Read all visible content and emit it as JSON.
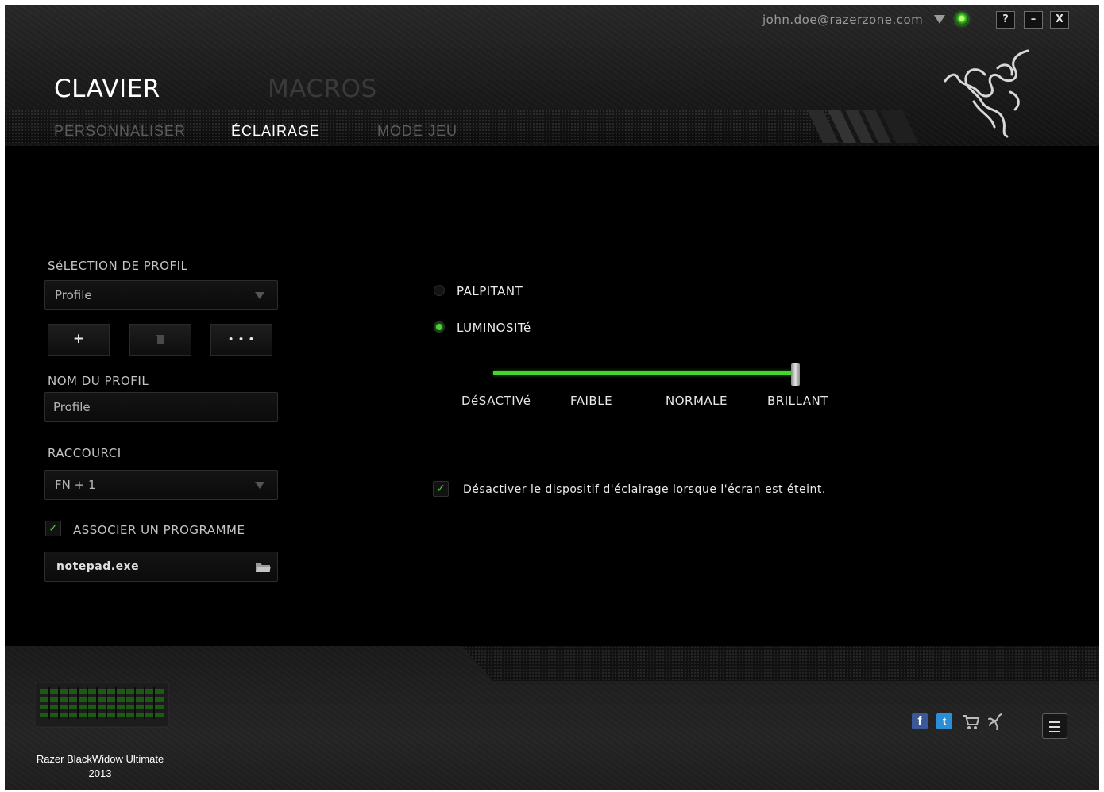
{
  "account": {
    "email": "john.doe@razerzone.com"
  },
  "window_controls": {
    "help": "?",
    "minimize": "–",
    "close": "X"
  },
  "tabs": {
    "primary": [
      "CLAVIER",
      "MACROS"
    ],
    "secondary": [
      "PERSONNALISER",
      "ÉCLAIRAGE",
      "MODE JEU"
    ]
  },
  "profile": {
    "selection_label": "SéLECTION DE PROFIL",
    "selected": "Profile",
    "add": "+",
    "more": "• • •",
    "name_label": "NOM DU PROFIL",
    "name_value": "Profile",
    "shortcut_label": "RACCOURCI",
    "shortcut_value": "FN + 1",
    "link_program_label": "ASSOCIER UN PROGRAMME",
    "link_program_checked": true,
    "program_path": "notepad.exe"
  },
  "lighting": {
    "pulsating_label": "PALPITANT",
    "pulsating_selected": false,
    "brightness_label": "LUMINOSITé",
    "brightness_selected": true,
    "levels": [
      "DéSACTIVé",
      "FAIBLE",
      "NORMALE",
      "BRILLANT"
    ],
    "brightness_level": "BRILLANT",
    "screen_off_label": "Désactiver le dispositif d'éclairage lorsque l'écran est éteint.",
    "screen_off_checked": true
  },
  "device": {
    "name_line1": "Razer BlackWidow Ultimate",
    "name_line2": "2013"
  },
  "footer_icons": [
    "facebook-icon",
    "twitter-icon",
    "cart-icon",
    "razer-icon",
    "menu-icon"
  ],
  "colors": {
    "accent": "#44d62c",
    "background": "#000000",
    "text": "#c4c4c4"
  }
}
